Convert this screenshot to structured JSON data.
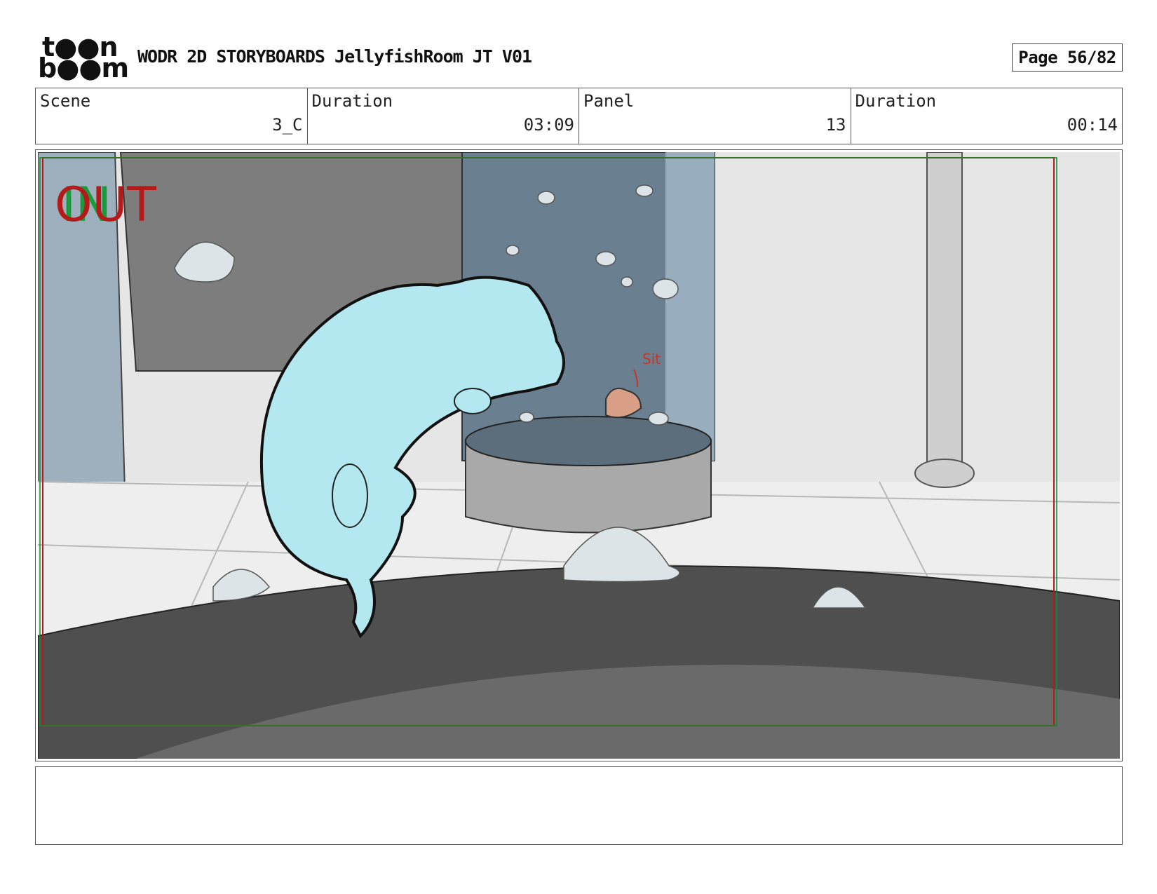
{
  "header": {
    "logo_top": "t●●n",
    "logo_bottom": "b●●m",
    "title": "WODR 2D STORYBOARDS JellyfishRoom JT V01",
    "page": "Page 56/82"
  },
  "info": {
    "scene_label": "Scene",
    "scene_value": "3_C",
    "duration_label": "Duration",
    "duration_value": "03:09",
    "panel_label": "Panel",
    "panel_value": "13",
    "panel_duration_label": "Duration",
    "panel_duration_value": "00:14"
  },
  "panel": {
    "in_marker": "IN",
    "out_marker": "OUT",
    "annotation": "Sit"
  },
  "notes": {
    "text": ""
  }
}
